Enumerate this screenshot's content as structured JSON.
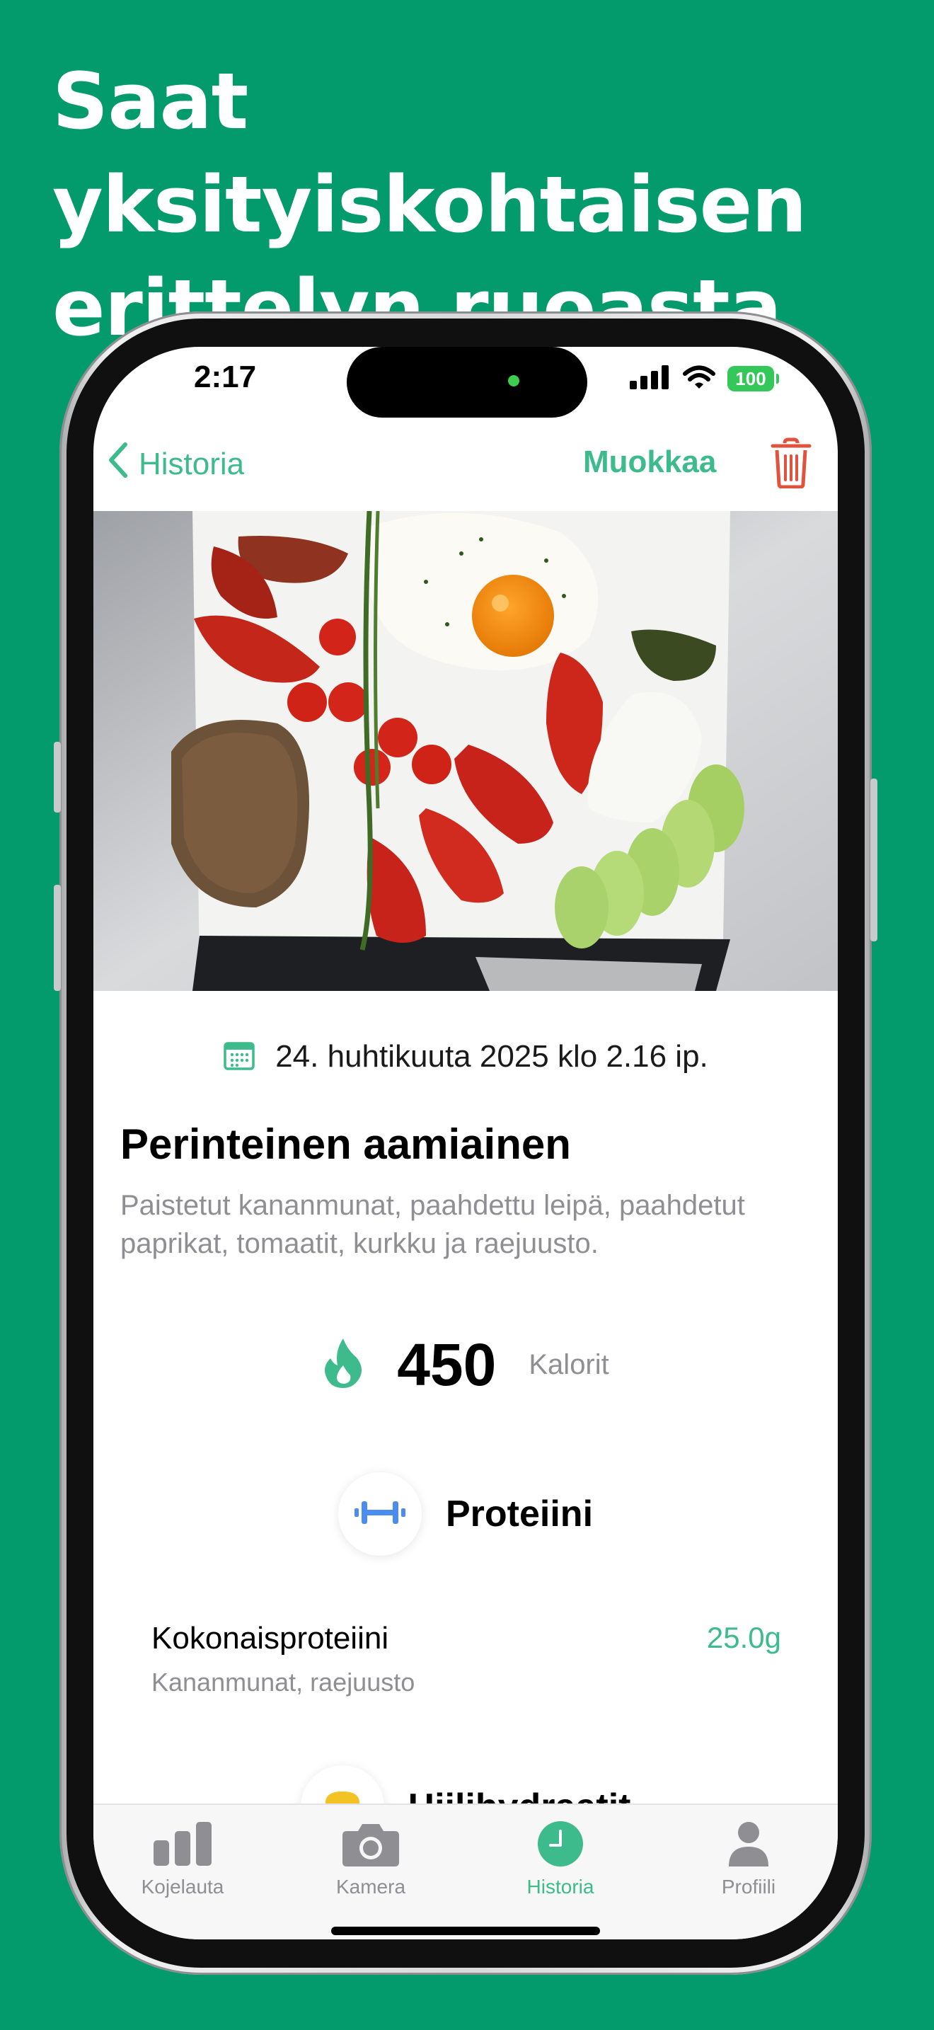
{
  "headline": "Saat yksityiskohtaisen erittelyn ruoasta",
  "status_bar": {
    "time": "2:17",
    "battery": "100"
  },
  "nav": {
    "back_label": "Historia",
    "edit_label": "Muokkaa"
  },
  "meal": {
    "datetime": "24. huhtikuuta 2025 klo 2.16 ip.",
    "title": "Perinteinen aamiainen",
    "description": "Paistetut kananmunat, paahdettu leipä, paahdetut paprikat, tomaatit, kurkku ja raejuusto.",
    "calories_value": "450",
    "calories_label": "Kalorit"
  },
  "protein": {
    "section_title": "Proteiini",
    "total_label": "Kokonaisproteiini",
    "total_value": "25.0g",
    "sources": "Kananmunat, raejuusto"
  },
  "carbs": {
    "section_title": "Hiilihydraatit"
  },
  "tabs": [
    {
      "label": "Kojelauta",
      "icon": "bar-chart-icon"
    },
    {
      "label": "Kamera",
      "icon": "camera-icon"
    },
    {
      "label": "Historia",
      "icon": "clock-icon"
    },
    {
      "label": "Profiili",
      "icon": "person-icon"
    }
  ],
  "colors": {
    "background": "#039a6c",
    "accent": "#3dbb8c",
    "delete": "#e0533d",
    "protein_icon": "#4a8cf0",
    "carbs_icon": "#f3c323"
  }
}
